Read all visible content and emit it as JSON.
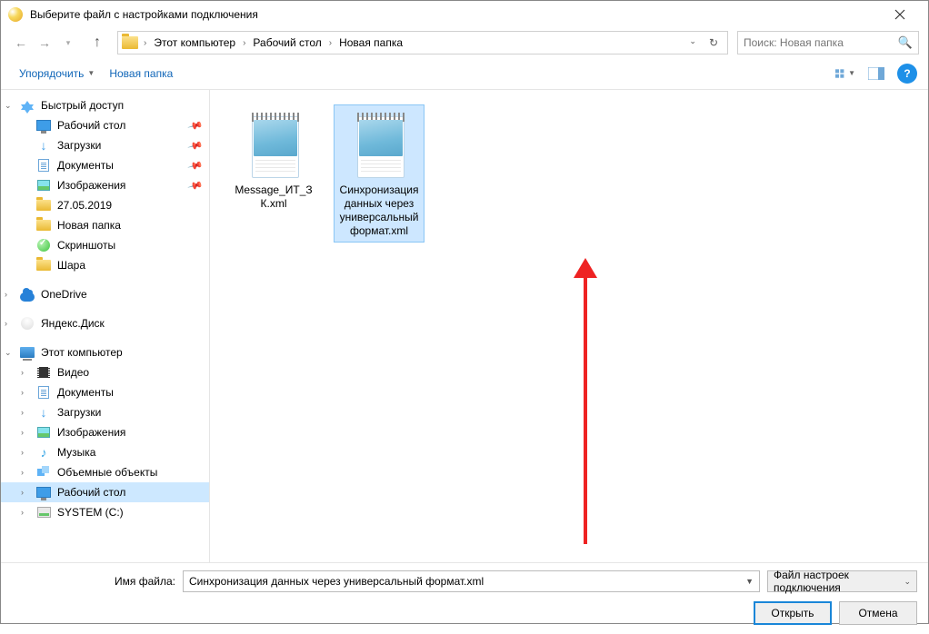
{
  "window": {
    "title": "Выберите файл с настройками подключения"
  },
  "nav": {
    "breadcrumb": {
      "root": "Этот компьютер",
      "p1": "Рабочий стол",
      "p2": "Новая папка"
    }
  },
  "search": {
    "placeholder": "Поиск: Новая папка"
  },
  "toolbar": {
    "organize": "Упорядочить",
    "newfolder": "Новая папка"
  },
  "sidebar": {
    "quick": "Быстрый доступ",
    "desktop": "Рабочий стол",
    "downloads": "Загрузки",
    "documents": "Документы",
    "pictures": "Изображения",
    "f1": "27.05.2019",
    "f2": "Новая папка",
    "f3": "Скриншоты",
    "f4": "Шара",
    "onedrive": "OneDrive",
    "ydisk": "Яндекс.Диск",
    "thispc": "Этот компьютер",
    "videos": "Видео",
    "documents2": "Документы",
    "downloads2": "Загрузки",
    "pictures2": "Изображения",
    "music": "Музыка",
    "objects3d": "Объемные объекты",
    "desktop2": "Рабочий стол",
    "sysc": "SYSTEM (C:)"
  },
  "files": {
    "item1": "Message_ИТ_ЗК.xml",
    "item2": "Синхронизация данных через универсальный формат.xml"
  },
  "bottom": {
    "filename_label": "Имя файла:",
    "filename_value": "Синхронизация данных через универсальный формат.xml",
    "filter": "Файл настроек подключения",
    "open": "Открыть",
    "cancel": "Отмена"
  }
}
